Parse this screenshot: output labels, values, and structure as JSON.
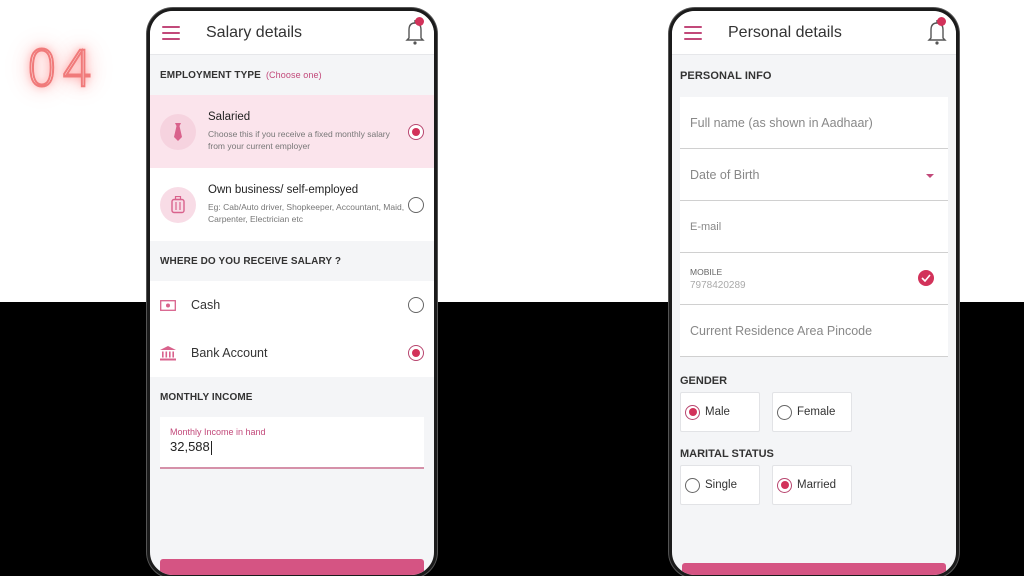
{
  "step": "04",
  "colors": {
    "accent": "#d2325a",
    "accent_light": "#fbe4ec",
    "button": "#d55483"
  },
  "salary_screen": {
    "title": "Salary details",
    "menu_icon": "hamburger-icon",
    "notification_icon": "bell-icon",
    "employment_type": {
      "label": "EMPLOYMENT TYPE",
      "hint": "(Choose one)",
      "options": [
        {
          "icon": "tie-icon",
          "title": "Salaried",
          "description": "Choose this if you receive a fixed monthly salary from your current employer",
          "selected": true
        },
        {
          "icon": "briefcase-icon",
          "title": "Own business/ self-employed",
          "description": "Eg: Cab/Auto driver, Shopkeeper, Accountant, Maid, Carpenter, Electrician etc",
          "selected": false
        }
      ]
    },
    "receive_salary": {
      "label": "WHERE DO YOU RECEIVE SALARY ?",
      "options": [
        {
          "icon": "cash-icon",
          "label": "Cash",
          "selected": false
        },
        {
          "icon": "bank-icon",
          "label": "Bank Account",
          "selected": true
        }
      ]
    },
    "monthly_income": {
      "label": "MONTHLY INCOME",
      "field_label": "Monthly Income in hand",
      "value": "32,588"
    }
  },
  "personal_screen": {
    "title": "Personal details",
    "menu_icon": "hamburger-icon",
    "notification_icon": "bell-icon",
    "personal_info": {
      "label": "PERSONAL INFO",
      "full_name_placeholder": "Full name (as shown in Aadhaar)",
      "dob_placeholder": "Date of Birth",
      "email_placeholder": "E-mail",
      "mobile_label": "MOBILE",
      "mobile_value": "7978420289",
      "mobile_verified": true,
      "pincode_placeholder": "Current Residence Area Pincode"
    },
    "gender": {
      "label": "GENDER",
      "options": [
        {
          "label": "Male",
          "selected": true
        },
        {
          "label": "Female",
          "selected": false
        }
      ]
    },
    "marital_status": {
      "label": "MARITAL STATUS",
      "options": [
        {
          "label": "Single",
          "selected": false
        },
        {
          "label": "Married",
          "selected": true
        }
      ]
    }
  }
}
